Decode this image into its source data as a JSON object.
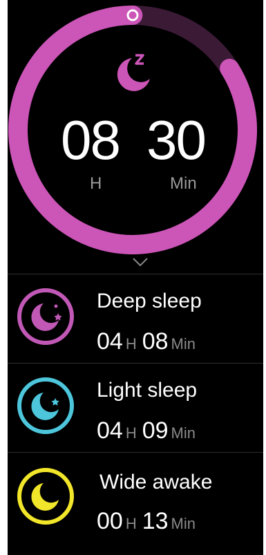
{
  "total_sleep": {
    "hours": "08",
    "minutes": "30",
    "hours_unit": "H",
    "minutes_unit": "Min",
    "progress": 0.84,
    "ring_color": "#cc55b8",
    "ring_track_color": "#3b1a36",
    "icon": "moon-sleep-icon"
  },
  "sleep_stages": [
    {
      "label": "Deep sleep",
      "hours": "04",
      "hours_unit": "H",
      "minutes": "08",
      "minutes_unit": "Min",
      "color": "#c158b6",
      "icon": "moon-stars-icon"
    },
    {
      "label": "Light sleep",
      "hours": "04",
      "hours_unit": "H",
      "minutes": "09",
      "minutes_unit": "Min",
      "color": "#4dc6dc",
      "icon": "moon-star-icon"
    },
    {
      "label": "Wide awake",
      "hours": "00",
      "hours_unit": "H",
      "minutes": "13",
      "minutes_unit": "Min",
      "color": "#f2e62a",
      "icon": "moon-icon"
    }
  ]
}
